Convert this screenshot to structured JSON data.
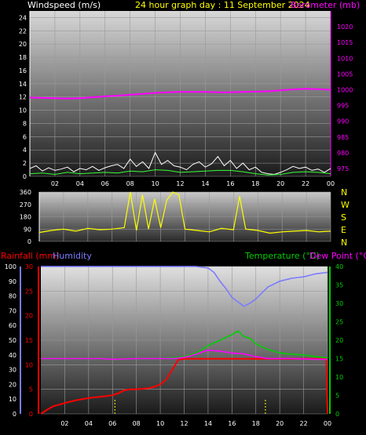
{
  "colors": {
    "wind_gust": "#ffffff",
    "wind_avg": "#33ff33",
    "barometer": "#ff00ff",
    "direction": "#ffff00",
    "rainfall": "#ff0000",
    "humidity": "#7b7bff",
    "temperature": "#00d000",
    "dew_point": "#ff00ff",
    "title": "#ffff00"
  },
  "chart_data": [
    {
      "type": "line",
      "title": "24 hour graph day : 11 September 2024",
      "ylabel": "Windspeed (m/s)",
      "y2label": "Barometer (mb)",
      "ylim": [
        0,
        25
      ],
      "yticks": [
        0,
        2,
        4,
        6,
        8,
        10,
        12,
        14,
        16,
        18,
        20,
        22,
        24
      ],
      "y2lim": [
        972.5,
        1025
      ],
      "y2ticks": [
        975,
        980,
        985,
        990,
        995,
        1000,
        1005,
        1010,
        1015,
        1020
      ],
      "xlim": [
        0,
        24
      ],
      "xticks": [
        "02",
        "04",
        "06",
        "08",
        "10",
        "12",
        "14",
        "16",
        "18",
        "20",
        "22",
        "00"
      ],
      "series": [
        {
          "name": "Windspeed",
          "color": "#ffffff",
          "x": [
            0,
            0.5,
            1,
            1.5,
            2,
            2.5,
            3,
            3.5,
            4,
            4.5,
            5,
            5.5,
            6,
            6.5,
            7,
            7.5,
            8,
            8.5,
            9,
            9.5,
            10,
            10.5,
            11,
            11.5,
            12,
            12.5,
            13,
            13.5,
            14,
            14.5,
            15,
            15.5,
            16,
            16.5,
            17,
            17.5,
            18,
            18.5,
            19,
            19.5,
            20,
            20.5,
            21,
            21.5,
            22,
            22.5,
            23,
            23.5,
            24
          ],
          "values": [
            1.2,
            1.6,
            0.8,
            1.3,
            0.9,
            1.1,
            1.4,
            0.7,
            1.2,
            1.0,
            1.5,
            0.9,
            1.3,
            1.6,
            1.8,
            1.2,
            2.6,
            1.5,
            2.2,
            1.2,
            3.6,
            1.8,
            2.4,
            1.6,
            1.4,
            1.0,
            1.8,
            2.2,
            1.4,
            1.9,
            3.0,
            1.6,
            2.4,
            1.2,
            2.0,
            1.0,
            1.4,
            0.6,
            0.4,
            0.3,
            0.6,
            1.0,
            1.5,
            1.2,
            1.4,
            0.9,
            1.1,
            0.6,
            1.2
          ]
        },
        {
          "name": "Average",
          "color": "#33ff33",
          "x": [
            0,
            1,
            2,
            3,
            4,
            5,
            6,
            7,
            8,
            9,
            10,
            11,
            12,
            13,
            14,
            15,
            16,
            17,
            18,
            19,
            20,
            21,
            22,
            23,
            24
          ],
          "values": [
            0.4,
            0.5,
            0.3,
            0.6,
            0.4,
            0.5,
            0.6,
            0.5,
            0.8,
            0.7,
            1.0,
            0.9,
            0.6,
            0.7,
            0.8,
            0.9,
            0.9,
            0.7,
            0.4,
            0.2,
            0.3,
            0.6,
            0.7,
            0.6,
            0.4
          ]
        },
        {
          "name": "Barometer",
          "color": "#ff00ff",
          "axis": "right",
          "x": [
            0,
            1,
            2,
            3,
            4,
            5,
            6,
            7,
            8,
            9,
            10,
            11,
            12,
            13,
            14,
            15,
            16,
            17,
            18,
            19,
            20,
            21,
            22,
            23,
            24
          ],
          "values": [
            997.5,
            997.4,
            997.3,
            997.2,
            997.3,
            997.6,
            997.9,
            998.1,
            998.4,
            998.7,
            999.0,
            999.2,
            999.3,
            999.3,
            999.3,
            999.2,
            999.2,
            999.3,
            999.4,
            999.5,
            999.8,
            1000.1,
            1000.3,
            1000.2,
            1000.0
          ]
        }
      ]
    },
    {
      "type": "scatter",
      "ylim": [
        0,
        360
      ],
      "yticks": [
        0,
        90,
        180,
        270,
        360
      ],
      "direction_labels": [
        "N",
        "W",
        "S",
        "E",
        "N"
      ],
      "series": [
        {
          "name": "Wind direction",
          "color": "#ffff00",
          "x": [
            0,
            1,
            2,
            3,
            4,
            5,
            6,
            7,
            7.5,
            8,
            8.5,
            9,
            9.5,
            10,
            10.5,
            11,
            11.5,
            12,
            13,
            14,
            15,
            16,
            16.5,
            17,
            18,
            19,
            20,
            21,
            22,
            23,
            24
          ],
          "values": [
            65,
            80,
            90,
            75,
            95,
            85,
            90,
            100,
            360,
            80,
            340,
            90,
            310,
            100,
            300,
            360,
            340,
            90,
            80,
            70,
            95,
            85,
            330,
            90,
            80,
            60,
            70,
            75,
            80,
            70,
            75
          ]
        }
      ]
    },
    {
      "type": "line",
      "ylabel": "Rainfall (mm)",
      "y2label": "Humidity",
      "y3label": "Temperature (°C)",
      "y4label": "Dew Point (°C)",
      "rain_lim": [
        0,
        30
      ],
      "rain_ticks": [
        0,
        5,
        10,
        15,
        20,
        25,
        30
      ],
      "hum_lim": [
        0,
        100
      ],
      "hum_ticks": [
        0,
        10,
        20,
        30,
        40,
        50,
        60,
        70,
        80,
        90,
        100
      ],
      "temp_lim": [
        0,
        40
      ],
      "temp_ticks": [
        0,
        5,
        10,
        15,
        20,
        25,
        30,
        35,
        40
      ],
      "xlim": [
        0,
        24
      ],
      "xticks": [
        "02",
        "04",
        "06",
        "08",
        "10",
        "12",
        "14",
        "16",
        "18",
        "20",
        "22",
        "00"
      ],
      "series": [
        {
          "name": "Rainfall",
          "color": "#ff0000",
          "axis": "rain",
          "x": [
            0,
            0.5,
            1,
            2,
            3,
            4,
            5,
            5.5,
            6,
            6.5,
            7,
            7.5,
            8,
            8.5,
            9,
            9.5,
            10,
            10.5,
            11,
            11.5,
            12,
            23.9,
            24
          ],
          "values": [
            0,
            0.8,
            1.5,
            2.2,
            2.8,
            3.2,
            3.5,
            3.6,
            3.8,
            4.2,
            4.8,
            5.0,
            5.0,
            5.1,
            5.2,
            5.5,
            6.0,
            7.0,
            9.0,
            11.0,
            11.2,
            11.2,
            0
          ]
        },
        {
          "name": "Humidity",
          "color": "#7b7bff",
          "axis": "hum",
          "x": [
            0,
            1,
            2,
            3,
            4,
            5,
            6,
            7,
            8,
            9,
            10,
            11,
            12,
            13,
            14,
            14.5,
            15,
            15.5,
            16,
            16.5,
            17,
            17.5,
            18,
            18.5,
            19,
            20,
            21,
            22,
            23,
            24
          ],
          "values": [
            100,
            100,
            100,
            100,
            100,
            100,
            100,
            100,
            100,
            100,
            100,
            100,
            100,
            100,
            99,
            96,
            90,
            85,
            79,
            76,
            73,
            75,
            78,
            82,
            86,
            90,
            92,
            93,
            95,
            96
          ]
        },
        {
          "name": "Temperature",
          "color": "#00d000",
          "axis": "temp",
          "x": [
            0,
            1,
            2,
            3,
            4,
            5,
            6,
            7,
            8,
            9,
            10,
            11,
            12,
            13,
            14,
            15,
            16,
            16.5,
            17,
            17.5,
            18,
            19,
            20,
            21,
            22,
            23,
            24
          ],
          "values": [
            15,
            15,
            15,
            15,
            15,
            15,
            14.8,
            14.9,
            15,
            15,
            15,
            15.2,
            15.5,
            16.5,
            18.5,
            20,
            21.5,
            22.5,
            21,
            20.5,
            19,
            17.5,
            16.5,
            16.2,
            16,
            15.5,
            15.2
          ]
        },
        {
          "name": "Dew Point",
          "color": "#ff00ff",
          "axis": "temp",
          "x": [
            0,
            1,
            2,
            3,
            4,
            5,
            6,
            7,
            8,
            9,
            10,
            11,
            12,
            13,
            14,
            15,
            16,
            17,
            18,
            19,
            20,
            21,
            22,
            23,
            24
          ],
          "values": [
            15,
            15,
            15,
            15,
            15,
            15,
            14.8,
            14.9,
            15,
            15,
            15,
            15,
            15.3,
            16.2,
            17.3,
            17,
            16.5,
            16.3,
            15.5,
            15,
            15,
            15,
            14.9,
            14.8,
            14.8
          ]
        }
      ],
      "markers_x": [
        6.2,
        18.8
      ]
    }
  ]
}
